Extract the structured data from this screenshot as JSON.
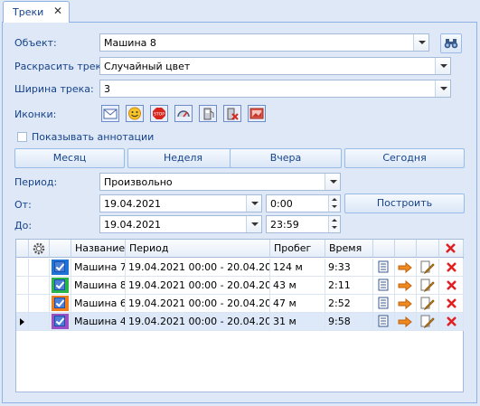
{
  "tab": {
    "label": "Треки"
  },
  "form": {
    "object_label": "Объект:",
    "object_value": "Машина 8",
    "color_label": "Раскрасить трек:",
    "color_value": "Случайный цвет",
    "width_label": "Ширина трека:",
    "width_value": "3",
    "icons_label": "Иконки:",
    "icons": [
      "envelope-icon",
      "smiley-icon",
      "stop-sign-icon",
      "speedometer-icon",
      "fuel-icon",
      "fuel-cancel-icon",
      "gallery-icon"
    ],
    "annotations_label": "Показывать аннотации",
    "annotations_checked": false
  },
  "quick": {
    "month": "Месяц",
    "week": "Неделя",
    "yesterday": "Вчера",
    "today": "Сегодня"
  },
  "period": {
    "label": "Период:",
    "value": "Произвольно",
    "from_label": "От:",
    "from_date": "19.04.2021",
    "from_time": "0:00",
    "to_label": "До:",
    "to_date": "19.04.2021",
    "to_time": "23:59",
    "build": "Построить"
  },
  "table": {
    "headers": {
      "name": "Название",
      "period": "Период",
      "mileage": "Пробег",
      "time": "Время"
    },
    "rows": [
      {
        "color": "#1e73d8",
        "checked": true,
        "name": "Машина 7",
        "period": "19.04.2021 00:00 - 20.04.20...",
        "mileage": "124 м",
        "time": "9:33"
      },
      {
        "color": "#27b54a",
        "checked": true,
        "name": "Машина 8",
        "period": "19.04.2021 00:00 - 20.04.20...",
        "mileage": "43 м",
        "time": "2:11"
      },
      {
        "color": "#f07d1a",
        "checked": true,
        "name": "Машина 6",
        "period": "19.04.2021 00:00 - 20.04.20...",
        "mileage": "47 м",
        "time": "2:52"
      },
      {
        "color": "#9b4fc4",
        "checked": true,
        "name": "Машина 4",
        "period": "19.04.2021 00:00 - 20.04.20...",
        "mileage": "31 м",
        "time": "9:58",
        "selected": true
      }
    ]
  }
}
